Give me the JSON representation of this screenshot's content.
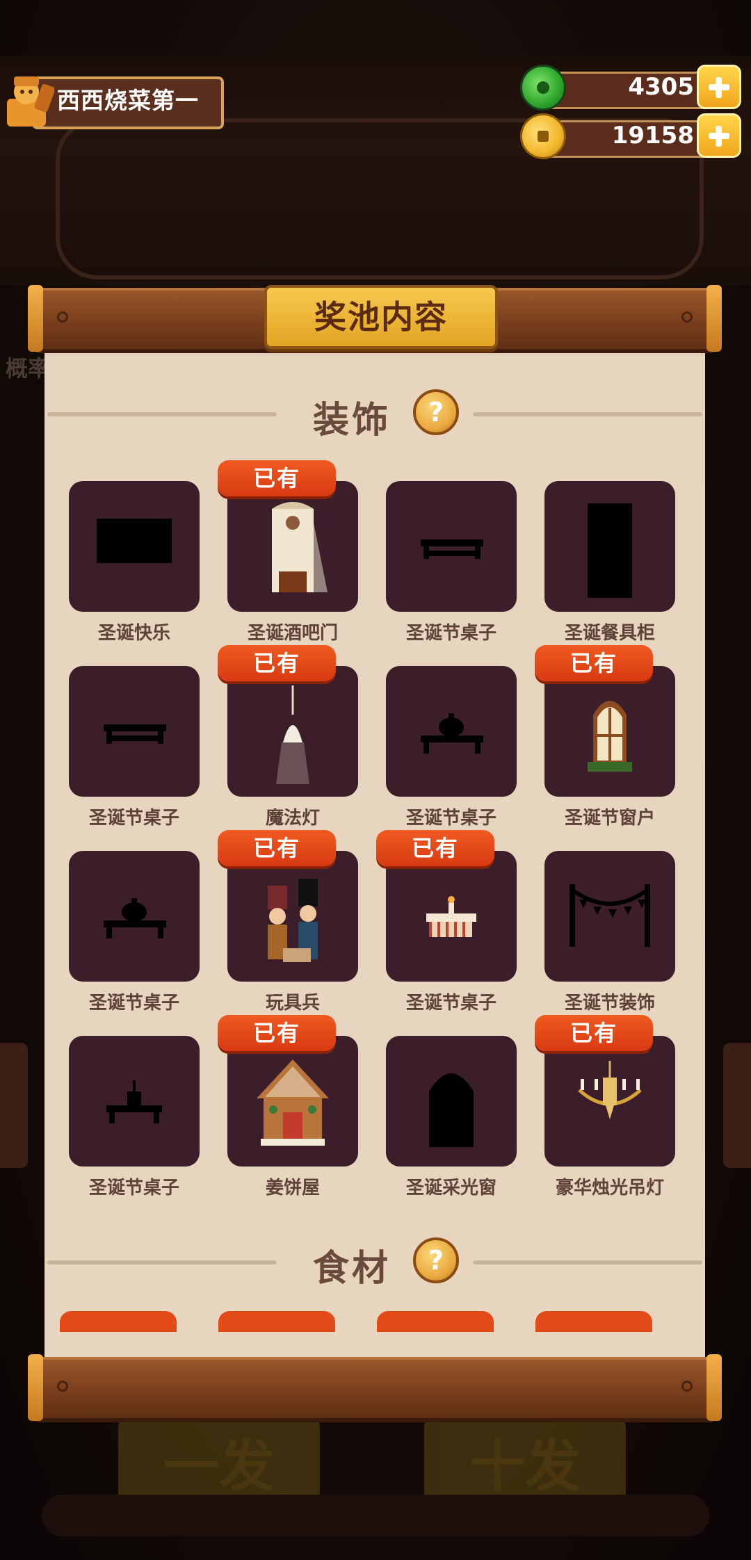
{
  "player": {
    "name": "西西烧菜第一"
  },
  "resources": [
    {
      "icon": "jade-coin-icon",
      "value": "4305"
    },
    {
      "icon": "gold-coin-icon",
      "value": "19158"
    }
  ],
  "panel": {
    "title": "奖池内容",
    "sections": [
      {
        "label": "装饰",
        "help": "?",
        "owned_label": "已有",
        "items": [
          {
            "name": "圣诞快乐",
            "owned": false
          },
          {
            "name": "圣诞酒吧门",
            "owned": true
          },
          {
            "name": "圣诞节桌子",
            "owned": false
          },
          {
            "name": "圣诞餐具柜",
            "owned": false
          },
          {
            "name": "圣诞节桌子",
            "owned": false
          },
          {
            "name": "魔法灯",
            "owned": true
          },
          {
            "name": "圣诞节桌子",
            "owned": false
          },
          {
            "name": "圣诞节窗户",
            "owned": true
          },
          {
            "name": "圣诞节桌子",
            "owned": false
          },
          {
            "name": "玩具兵",
            "owned": true
          },
          {
            "name": "圣诞节桌子",
            "owned": true
          },
          {
            "name": "圣诞节装饰",
            "owned": false
          },
          {
            "name": "圣诞节桌子",
            "owned": false
          },
          {
            "name": "姜饼屋",
            "owned": true
          },
          {
            "name": "圣诞采光窗",
            "owned": false
          },
          {
            "name": "豪华烛光吊灯",
            "owned": true
          }
        ]
      },
      {
        "label": "食材",
        "help": "?"
      }
    ]
  },
  "background": {
    "button_single": "一发",
    "button_ten": "十发",
    "side_hint": "概率"
  },
  "colors": {
    "owned_badge": "#e0441a",
    "tile": "#3b1e29",
    "paper": "#e8d5bf"
  }
}
